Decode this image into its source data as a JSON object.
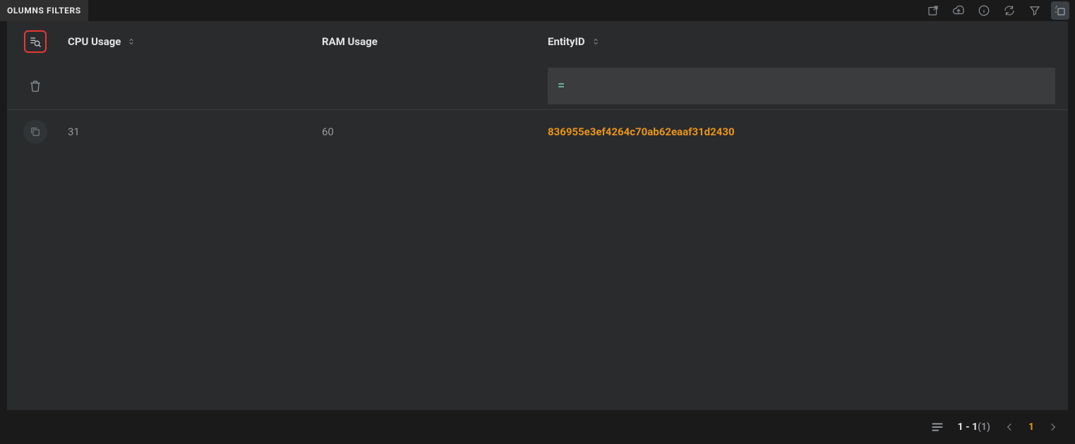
{
  "tabs": {
    "columns_filters": "OLUMNS FILTERS"
  },
  "columns": {
    "cpu": "CPU Usage",
    "ram": "RAM Usage",
    "entity": "EntityID"
  },
  "filters": {
    "entity_op": "="
  },
  "rows": [
    {
      "cpu": "31",
      "ram": "60",
      "entity": "836955e3ef4264c70ab62eaaf31d2430"
    }
  ],
  "pagination": {
    "range": "1 - 1",
    "total": "(1)",
    "current": "1"
  }
}
